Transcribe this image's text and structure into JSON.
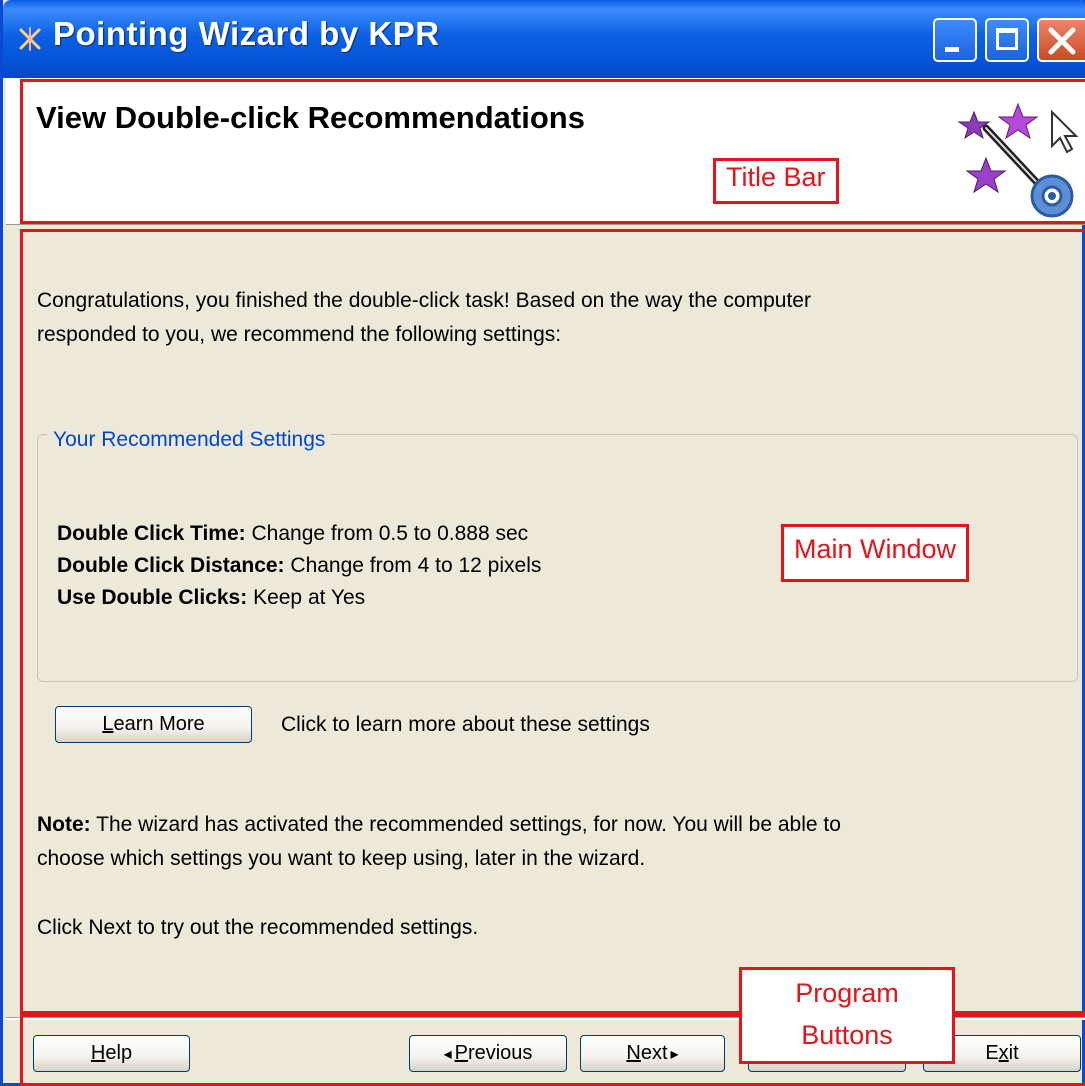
{
  "window": {
    "title": "Pointing Wizard by KPR"
  },
  "header": {
    "page_title": "View Double-click Recommendations"
  },
  "annotations": {
    "title_bar": "Title Bar",
    "main_window": "Main Window",
    "program_buttons_line1": "Program",
    "program_buttons_line2": "Buttons"
  },
  "main": {
    "intro_line1": "Congratulations, you finished the double-click task! Based on the way the computer",
    "intro_line2": "responded to you, we recommend the following settings:",
    "group_title": "Your Recommended Settings",
    "settings": [
      {
        "label": "Double Click Time:",
        "value": " Change from 0.5 to 0.888 sec"
      },
      {
        "label": "Double Click Distance:",
        "value": " Change from 4 to 12 pixels"
      },
      {
        "label": "Use Double Clicks:",
        "value": " Keep at Yes"
      }
    ],
    "learn_more_label_mnemonic": "L",
    "learn_more_label_rest": "earn More",
    "learn_more_hint": "Click to learn more about these settings",
    "note_label": "Note:",
    "note_line1": " The wizard has activated the recommended settings, for now. You will be able to",
    "note_line2": "choose which settings you want to keep using, later in the wizard.",
    "next_hint": "Click Next to try out the recommended settings."
  },
  "footer": {
    "help_mnemonic": "H",
    "help_rest": "elp",
    "previous_arrow": "◂",
    "previous_mnemonic": "P",
    "previous_rest": "revious",
    "next_mnemonic": "N",
    "next_rest": "ext",
    "next_arrow": "▸",
    "exit_pre": "E",
    "exit_mnemonic": "x",
    "exit_rest": "it"
  },
  "colors": {
    "accent": "#0046d5",
    "annotation": "#e4141b",
    "titlebar": "#0b61e3"
  }
}
